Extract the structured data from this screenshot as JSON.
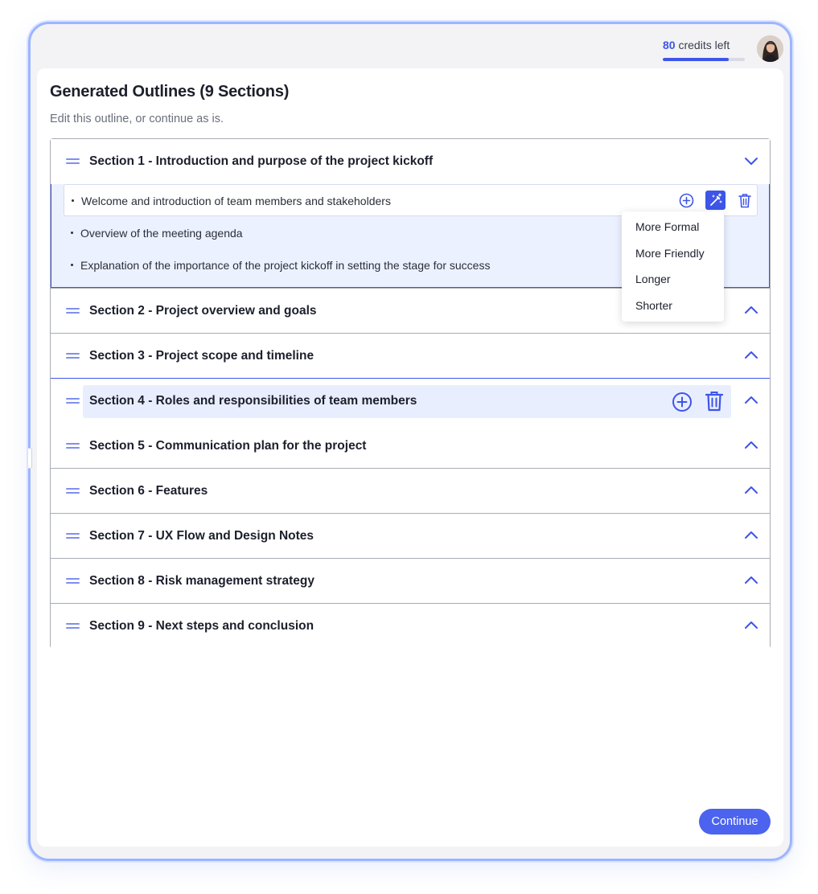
{
  "header": {
    "credits_count": "80",
    "credits_suffix": " credits left",
    "credits_fraction": 0.8
  },
  "page": {
    "title": "Generated Outlines (9 Sections)",
    "subtitle": "Edit this outline, or continue as is."
  },
  "sections": [
    {
      "title": "Section 1 - Introduction and purpose of the project kickoff",
      "expanded": true
    },
    {
      "title": "Section 2 - Project overview and goals"
    },
    {
      "title": "Section 3 - Project scope and timeline"
    },
    {
      "title": "Section 4 - Roles and responsibilities of team members"
    },
    {
      "title": "Section 5 - Communication plan for the project"
    },
    {
      "title": "Section 6 - Features"
    },
    {
      "title": "Section 7 - UX Flow and Design Notes"
    },
    {
      "title": "Section 8 - Risk management strategy"
    },
    {
      "title": "Section 9 - Next steps and conclusion"
    }
  ],
  "section1_bullets": [
    "Welcome and introduction of team members and stakeholders",
    "Overview of the meeting agenda",
    "Explanation of the importance of the project kickoff in setting the stage for success"
  ],
  "rewrite_menu": {
    "options": [
      "More Formal",
      "More Friendly",
      "Longer",
      "Shorter"
    ]
  },
  "actions": {
    "continue_label": "Continue"
  },
  "colors": {
    "accent": "#3d55e8",
    "expanded_bg": "#ecf1ff",
    "device_border": "#9db5ff"
  },
  "icons": [
    "drag-handle-icon",
    "chevron-down-icon",
    "chevron-up-icon",
    "add-circle-icon",
    "magic-wand-icon",
    "trash-icon",
    "avatar"
  ]
}
